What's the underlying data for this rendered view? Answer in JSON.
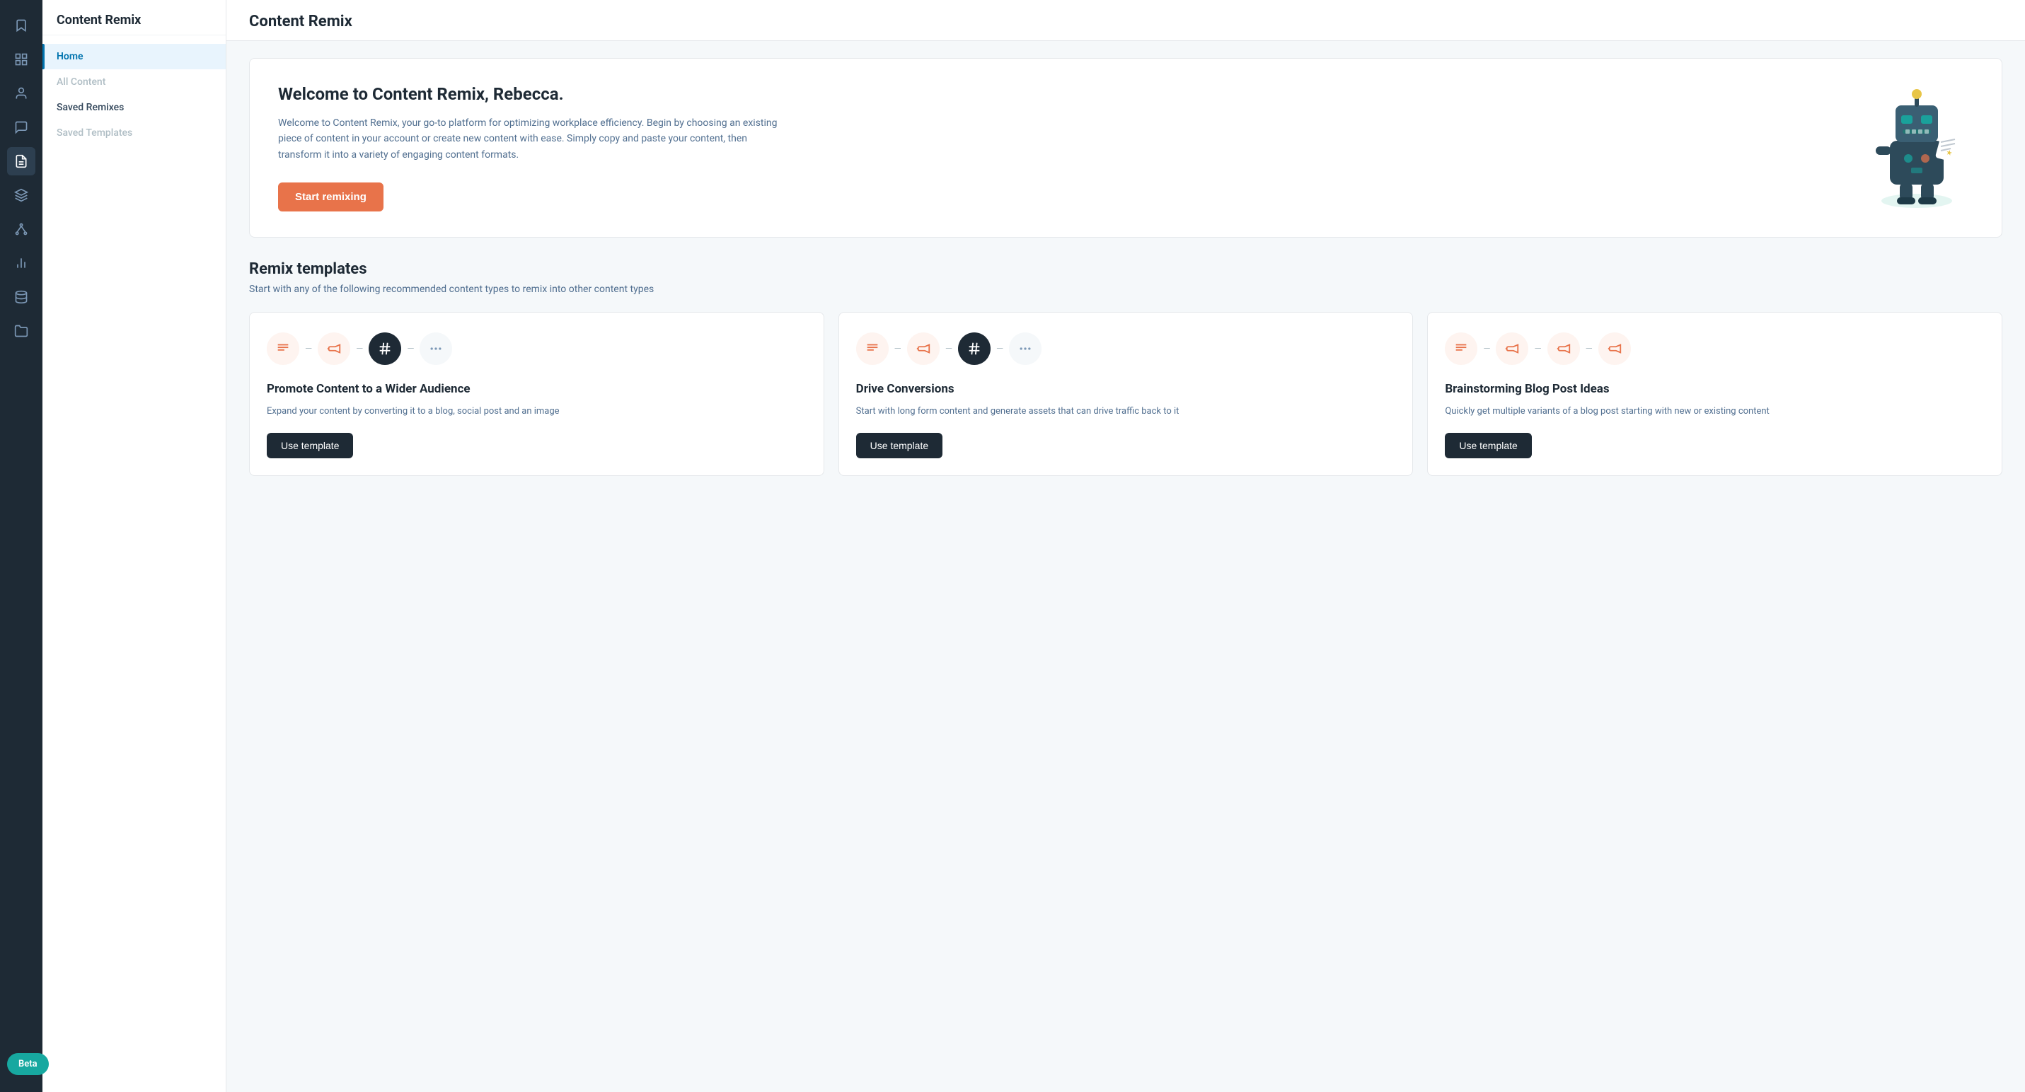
{
  "app": {
    "title": "Content Remix"
  },
  "icon_sidebar": {
    "items": [
      {
        "name": "bookmark-icon",
        "symbol": "🔖",
        "active": false
      },
      {
        "name": "dashboard-icon",
        "symbol": "⊞",
        "active": false
      },
      {
        "name": "contacts-icon",
        "symbol": "👤",
        "active": false
      },
      {
        "name": "chat-icon",
        "symbol": "💬",
        "active": false
      },
      {
        "name": "content-icon",
        "symbol": "📄",
        "active": true
      },
      {
        "name": "layers-icon",
        "symbol": "⧠",
        "active": false
      },
      {
        "name": "network-icon",
        "symbol": "⬡",
        "active": false
      },
      {
        "name": "chart-icon",
        "symbol": "📊",
        "active": false
      },
      {
        "name": "database-icon",
        "symbol": "🗄",
        "active": false
      },
      {
        "name": "folder-icon",
        "symbol": "📁",
        "active": false
      }
    ]
  },
  "nav_sidebar": {
    "header": "Content Remix",
    "items": [
      {
        "label": "Home",
        "active": true,
        "disabled": false
      },
      {
        "label": "All Content",
        "active": false,
        "disabled": true
      },
      {
        "label": "Saved Remixes",
        "active": false,
        "disabled": false
      },
      {
        "label": "Saved Templates",
        "active": false,
        "disabled": true
      }
    ]
  },
  "welcome": {
    "title": "Welcome to Content Remix, Rebecca.",
    "description": "Welcome to Content Remix, your go-to platform for optimizing workplace efficiency. Begin by choosing an existing piece of content in your account or create new content with ease. Simply copy and paste your content, then transform it into a variety of engaging content formats.",
    "cta_label": "Start remixing"
  },
  "templates_section": {
    "title": "Remix templates",
    "subtitle": "Start with any of the following recommended content types to remix into other content types",
    "cards": [
      {
        "title": "Promote Content to a Wider Audience",
        "description": "Expand your content by converting it to a blog, social post and an image",
        "btn_label": "Use template",
        "icons": [
          "text-icon",
          "megaphone-icon",
          "hashtag-icon",
          "more-icon"
        ]
      },
      {
        "title": "Drive Conversions",
        "description": "Start with long form content and generate assets that can drive traffic back to it",
        "btn_label": "Use template",
        "icons": [
          "text-icon",
          "megaphone-icon",
          "hashtag-icon",
          "more-icon"
        ]
      },
      {
        "title": "Brainstorming Blog Post Ideas",
        "description": "Quickly get multiple variants of a blog post starting with new or existing content",
        "btn_label": "Use template",
        "icons": [
          "text-icon",
          "megaphone-icon",
          "megaphone-icon",
          "megaphone-icon"
        ]
      }
    ]
  },
  "beta": {
    "label": "Beta"
  }
}
